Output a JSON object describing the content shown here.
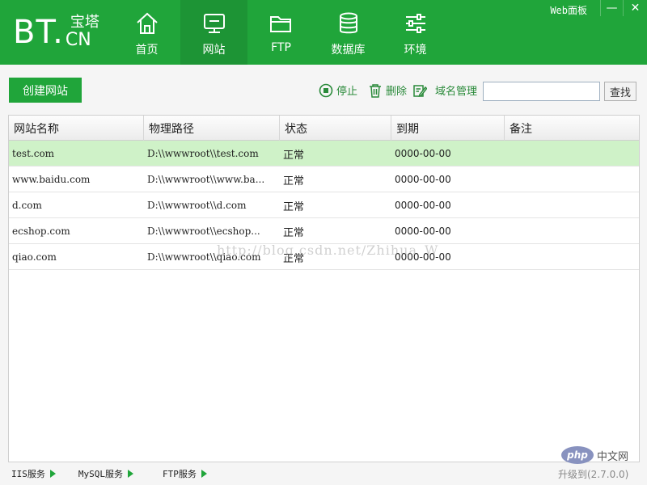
{
  "app": {
    "logo_main": "BT.",
    "logo_cn_name": "宝塔",
    "logo_cn": "CN",
    "web_panel_label": "Web面板",
    "minimize_symbol": "—",
    "close_symbol": "✕"
  },
  "nav": {
    "items": [
      {
        "label": "首页",
        "icon": "home-icon"
      },
      {
        "label": "网站",
        "icon": "monitor-icon",
        "active": true
      },
      {
        "label": "FTP",
        "icon": "folder-icon"
      },
      {
        "label": "数据库",
        "icon": "database-icon"
      },
      {
        "label": "环境",
        "icon": "sliders-icon"
      }
    ]
  },
  "toolbar": {
    "create_label": "创建网站",
    "stop_label": "停止",
    "delete_label": "删除",
    "domain_label": "域名管理",
    "search_placeholder": "",
    "search_button": "查找"
  },
  "table": {
    "columns": [
      "网站名称",
      "物理路径",
      "状态",
      "到期",
      "备注"
    ],
    "rows": [
      {
        "name": "test.com",
        "path": "D:\\\\wwwroot\\\\test.com",
        "status": "正常",
        "expiry": "0000-00-00",
        "note": "",
        "selected": true
      },
      {
        "name": "www.baidu.com",
        "path": "D:\\\\wwwroot\\\\www.ba...",
        "status": "正常",
        "expiry": "0000-00-00",
        "note": ""
      },
      {
        "name": "d.com",
        "path": "D:\\\\wwwroot\\\\d.com",
        "status": "正常",
        "expiry": "0000-00-00",
        "note": ""
      },
      {
        "name": "ecshop.com",
        "path": "D:\\\\wwwroot\\\\ecshop...",
        "status": "正常",
        "expiry": "0000-00-00",
        "note": ""
      },
      {
        "name": "qiao.com",
        "path": "D:\\\\wwwroot\\\\qiao.com",
        "status": "正常",
        "expiry": "0000-00-00",
        "note": ""
      }
    ]
  },
  "watermark": "http://blog.csdn.net/Zhihua_W",
  "statusbar": {
    "services": [
      "IIS服务",
      "MySQL服务",
      "FTP服务"
    ],
    "upgrade": "升级到(2.7.0.0)",
    "php_logo": "php",
    "php_site": "中文网"
  },
  "colors": {
    "brand": "#20a53a",
    "selected_row": "#cff2c8"
  }
}
